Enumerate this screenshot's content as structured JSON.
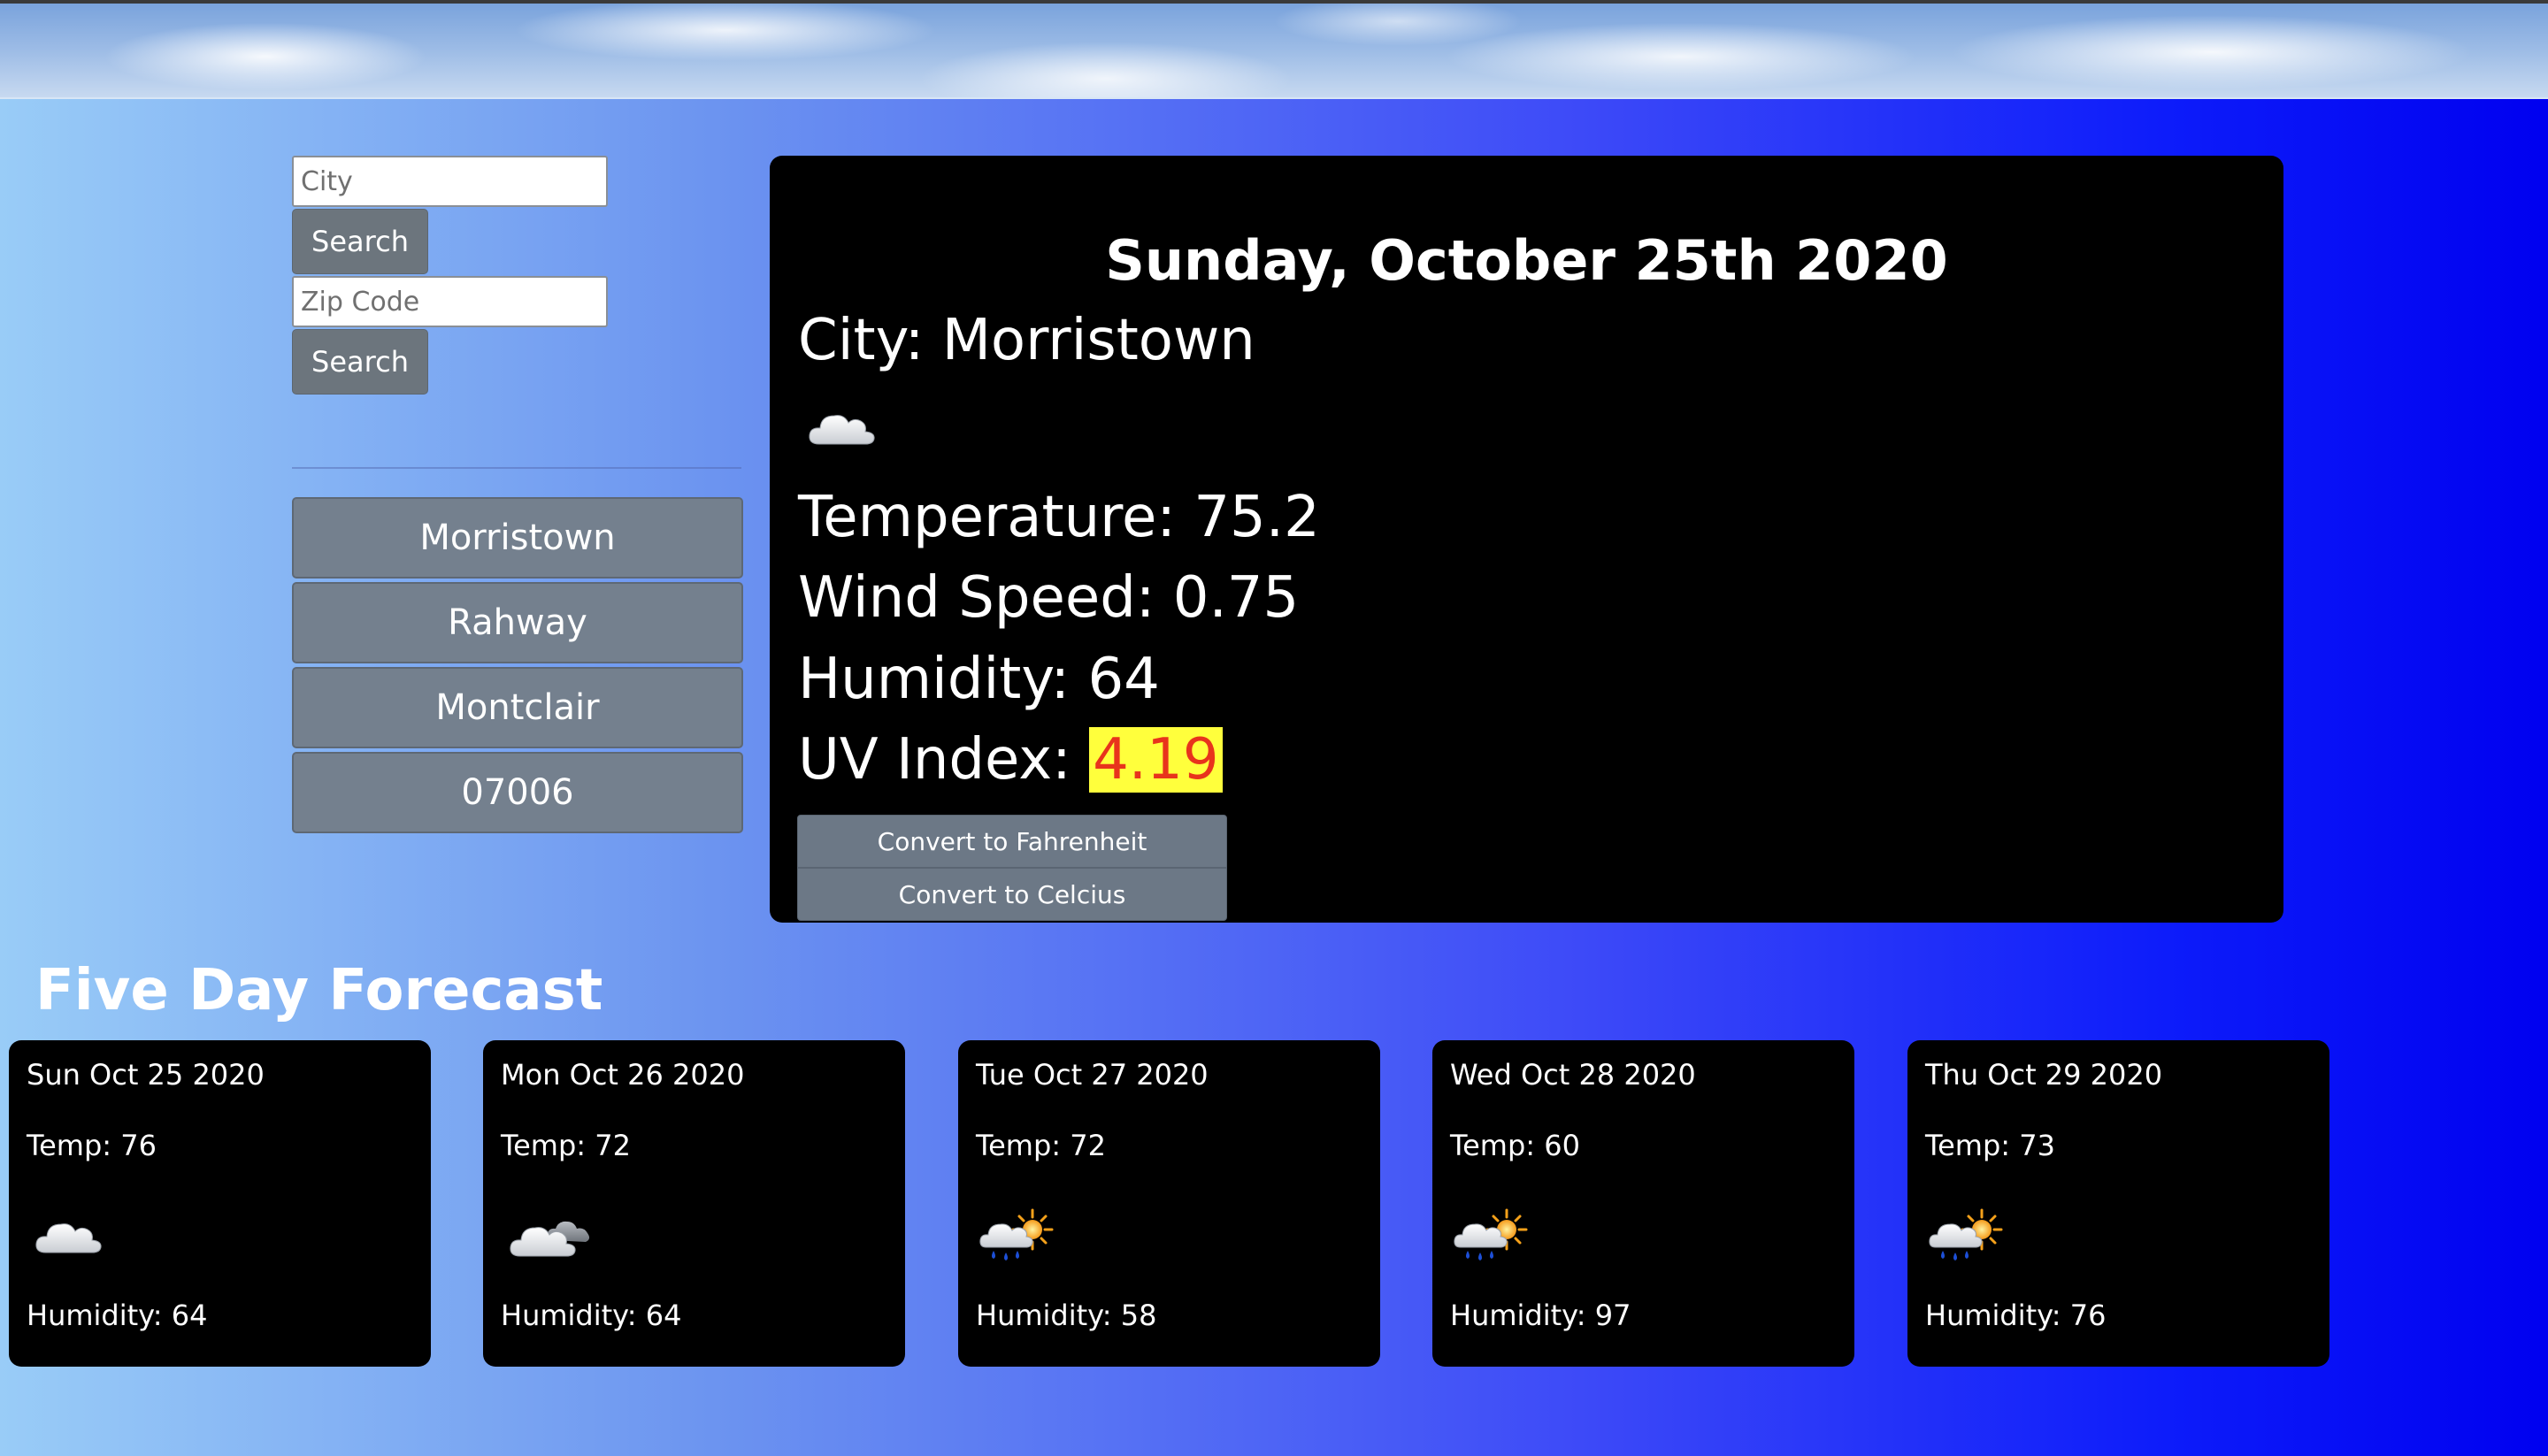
{
  "search": {
    "city_placeholder": "City",
    "city_button": "Search",
    "zip_placeholder": "Zip Code",
    "zip_button": "Search"
  },
  "history": [
    "Morristown",
    "Rahway",
    "Montclair",
    "07006"
  ],
  "current": {
    "date": "Sunday, October 25th 2020",
    "city_label": "City: ",
    "city": "Morristown",
    "icon": "cloud-icon",
    "temp_label": "Temperature: ",
    "temp": "75.2",
    "wind_label": "Wind Speed: ",
    "wind": "0.75",
    "humidity_label": "Humidity: ",
    "humidity": "64",
    "uv_label": "UV Index: ",
    "uv": "4.19",
    "uv_colors": {
      "background": "#ffff3c",
      "text": "#e8331c"
    },
    "to_fahrenheit": "Convert to Fahrenheit",
    "to_celcius": "Convert to Celcius"
  },
  "forecast": {
    "title": "Five Day Forecast",
    "days": [
      {
        "date": "Sun Oct 25 2020",
        "temp": "Temp: 76",
        "icon": "cloud-icon",
        "humidity": "Humidity: 64"
      },
      {
        "date": "Mon Oct 26 2020",
        "temp": "Temp: 72",
        "icon": "clouds-icon",
        "humidity": "Humidity: 64"
      },
      {
        "date": "Tue Oct 27 2020",
        "temp": "Temp: 72",
        "icon": "rain-sun-icon",
        "humidity": "Humidity: 58"
      },
      {
        "date": "Wed Oct 28 2020",
        "temp": "Temp: 60",
        "icon": "rain-sun-icon",
        "humidity": "Humidity: 97"
      },
      {
        "date": "Thu Oct 29 2020",
        "temp": "Temp: 73",
        "icon": "rain-sun-icon",
        "humidity": "Humidity: 76"
      }
    ]
  }
}
